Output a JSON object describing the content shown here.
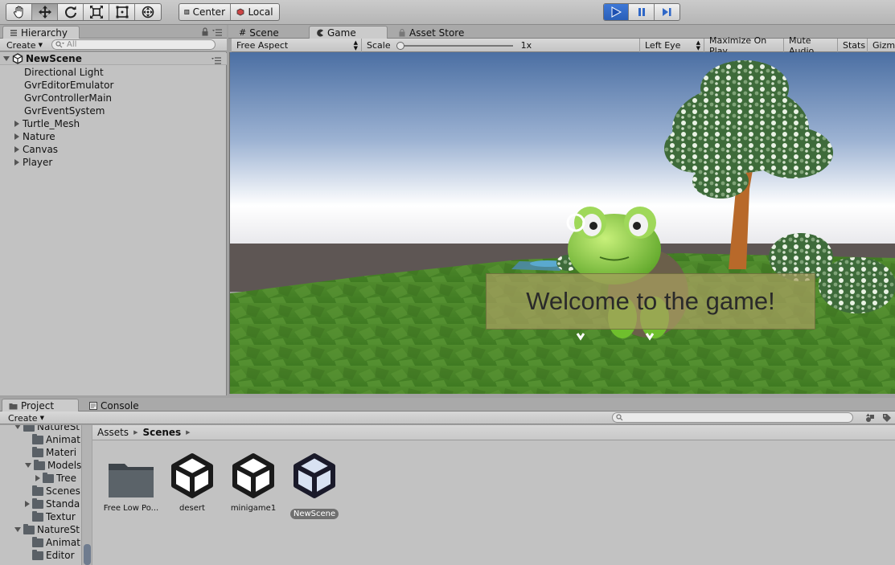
{
  "toolbar": {
    "tools": [
      {
        "name": "hand-tool",
        "icon": "hand-icon"
      },
      {
        "name": "move-tool",
        "icon": "move-arrows-icon",
        "active": true
      },
      {
        "name": "rotate-tool",
        "icon": "rotate-icon"
      },
      {
        "name": "scale-tool",
        "icon": "scale-icon"
      },
      {
        "name": "rect-tool",
        "icon": "rect-icon"
      },
      {
        "name": "transform-tool",
        "icon": "transform-icon"
      }
    ],
    "pivot_label": "Center",
    "space_label": "Local",
    "play_state": "playing",
    "accent": "#2f67c7"
  },
  "hierarchy": {
    "tab_label": "Hierarchy",
    "create_label": "Create",
    "search_placeholder": "All",
    "scene_name": "NewScene",
    "items": [
      {
        "label": "Directional Light",
        "expandable": false
      },
      {
        "label": "GvrEditorEmulator",
        "expandable": false
      },
      {
        "label": "GvrControllerMain",
        "expandable": false
      },
      {
        "label": "GvrEventSystem",
        "expandable": false
      },
      {
        "label": "Turtle_Mesh",
        "expandable": true
      },
      {
        "label": "Nature",
        "expandable": true
      },
      {
        "label": "Canvas",
        "expandable": true
      },
      {
        "label": "Player",
        "expandable": true
      }
    ]
  },
  "view_tabs": {
    "scene_label": "Scene",
    "game_label": "Game",
    "store_label": "Asset Store"
  },
  "game_toolbar": {
    "aspect": "Free Aspect",
    "scale_label": "Scale",
    "scale_value": "1x",
    "eye": "Left Eye",
    "maximize": "Maximize On Play",
    "mute": "Mute Audio",
    "stats": "Stats",
    "gizmos": "Gizmo"
  },
  "game": {
    "welcome_text": "Welcome to the game!"
  },
  "bottom_tabs": {
    "project_label": "Project",
    "console_label": "Console"
  },
  "project": {
    "create_label": "Create",
    "tree": [
      {
        "label": "NatureSt",
        "depth": 0,
        "open": true
      },
      {
        "label": "Animat",
        "depth": 1
      },
      {
        "label": "Materi",
        "depth": 1
      },
      {
        "label": "Models",
        "depth": 1,
        "open": true
      },
      {
        "label": "Tree",
        "depth": 2
      },
      {
        "label": "Scenes",
        "depth": 1
      },
      {
        "label": "Standa",
        "depth": 1
      },
      {
        "label": "Textur",
        "depth": 1
      },
      {
        "label": "NatureSt",
        "depth": 0,
        "open": true
      },
      {
        "label": "Animat",
        "depth": 1
      },
      {
        "label": "Editor",
        "depth": 1
      }
    ],
    "breadcrumb": {
      "root": "Assets",
      "current": "Scenes"
    },
    "assets": [
      {
        "label": "Free Low Po...",
        "kind": "folder"
      },
      {
        "label": "desert",
        "kind": "unity-scene"
      },
      {
        "label": "minigame1",
        "kind": "unity-scene"
      },
      {
        "label": "NewScene",
        "kind": "unity-scene",
        "selected": true
      }
    ]
  }
}
